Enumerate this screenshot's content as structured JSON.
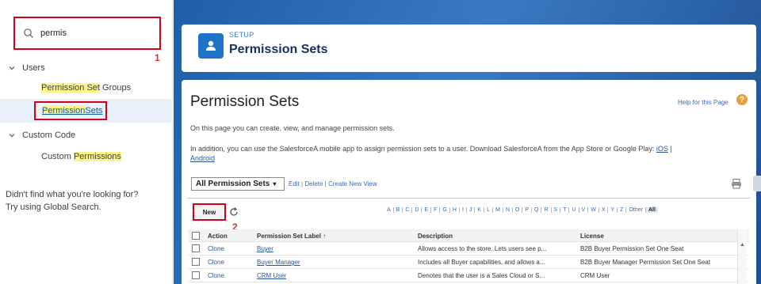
{
  "search": {
    "value": "permis"
  },
  "callouts": {
    "one": "1",
    "two": "2"
  },
  "sidebar": {
    "users_label": "Users",
    "psg_prefix": "Permission Set",
    "psg_suffix": " Groups",
    "ps_prefix": "Permission",
    "ps_middle": " Sets",
    "custom_code_label": "Custom Code",
    "cp_prefix": "Custom ",
    "cp_highlight": "Permissions",
    "help_line1": "Didn't find what you're looking for?",
    "help_line2": "Try using Global Search."
  },
  "header": {
    "eyebrow": "SETUP",
    "title": "Permission Sets"
  },
  "content": {
    "page_title": "Permission Sets",
    "help_link": "Help for this Page",
    "help_icon": "?",
    "desc1": "On this page you can create, view, and manage permission sets.",
    "desc2_text": "In addition, you can use the SalesforceA mobile app to assign permission sets to a user. Download SalesforceA from the App Store or Google Play: ",
    "desc2_ios": "iOS",
    "desc2_sep": " |",
    "android": "Android",
    "view_select": "All Permission Sets",
    "caret": "▾",
    "view_edit": "Edit",
    "view_delete": "Delete",
    "view_create": "Create New View",
    "view_sep": " | ",
    "new_button": "New",
    "alphabet": [
      "A",
      "B",
      "C",
      "D",
      "E",
      "F",
      "G",
      "H",
      "I",
      "J",
      "K",
      "L",
      "M",
      "N",
      "O",
      "P",
      "Q",
      "R",
      "S",
      "T",
      "U",
      "V",
      "W",
      "X",
      "Y",
      "Z",
      "Other",
      "All"
    ]
  },
  "table": {
    "headers": {
      "action": "Action",
      "label": "Permission Set Label ↑",
      "description": "Description",
      "license": "License"
    },
    "rows": [
      {
        "action": "Clone",
        "label": "Buyer",
        "description": "Allows access to the store. Lets users see p...",
        "license": "B2B Buyer Permission Set One Seat"
      },
      {
        "action": "Clone",
        "label": "Buyer Manager",
        "description": "Includes all Buyer capabilities, and allows a...",
        "license": "B2B Buyer Manager Permission Set One Seat"
      },
      {
        "action": "Clone",
        "label": "CRM User",
        "description": "Denotes that the user is a Sales Cloud or S...",
        "license": "CRM User"
      }
    ]
  }
}
